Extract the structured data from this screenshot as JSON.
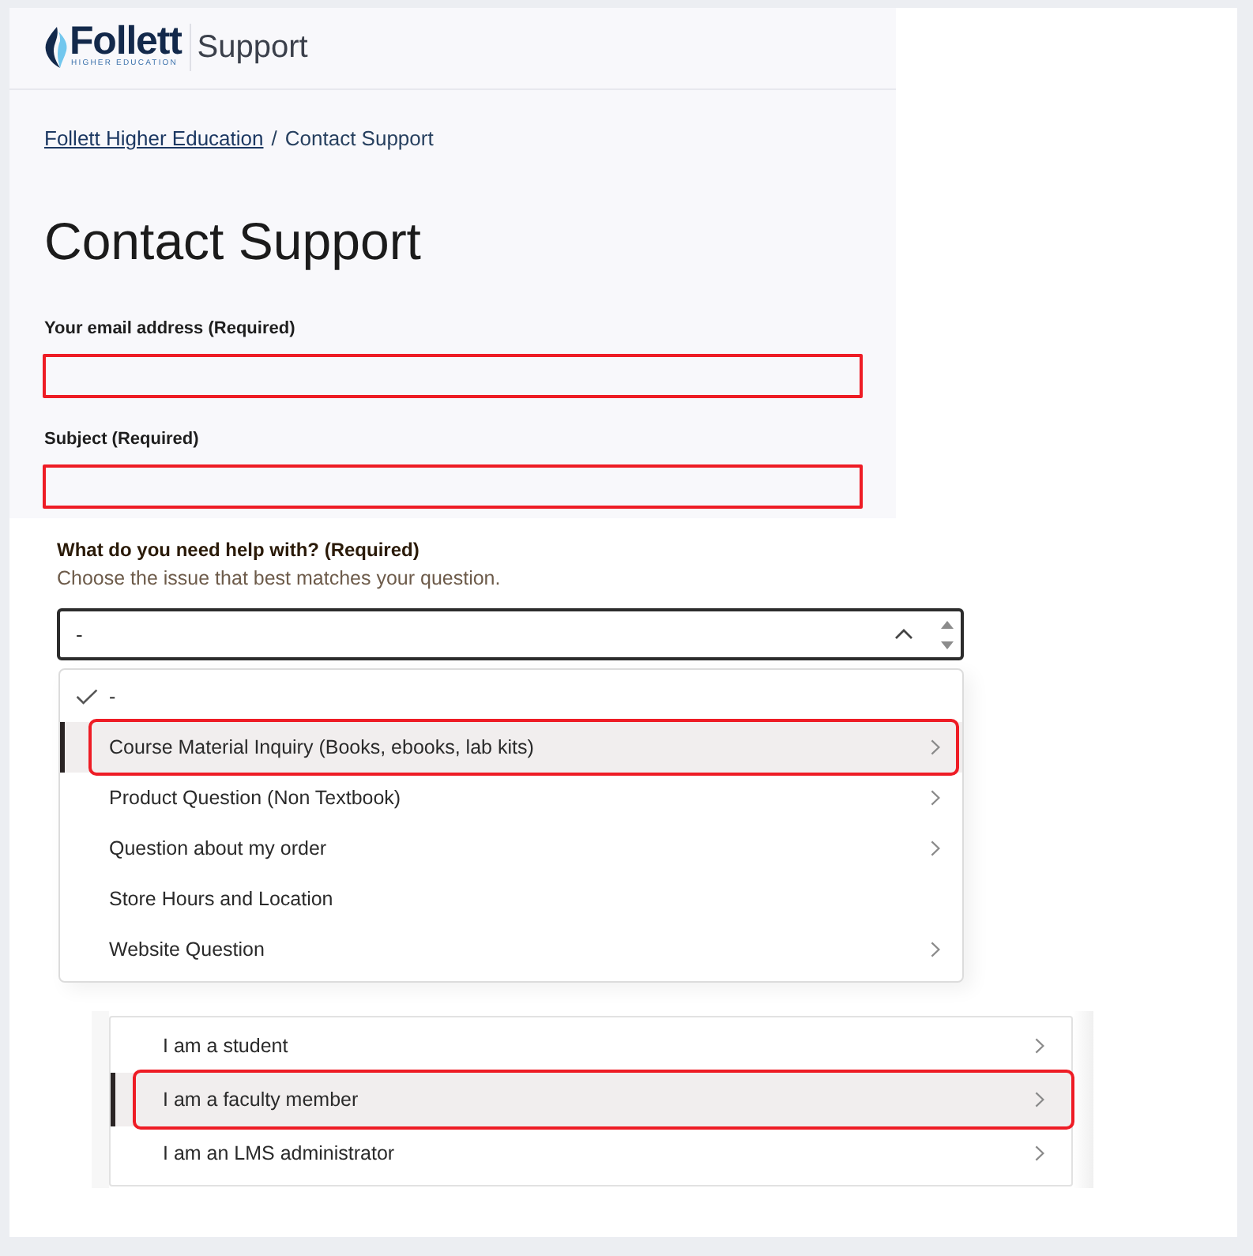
{
  "header": {
    "logo": {
      "wordmark": "Follett",
      "tagline": "HIGHER EDUCATION"
    },
    "title": "Support"
  },
  "breadcrumb": {
    "separator": "/",
    "items": [
      {
        "label": "Follett Higher Education",
        "link": true
      },
      {
        "label": "Contact Support",
        "link": false
      }
    ]
  },
  "page_title": "Contact Support",
  "fields": [
    {
      "label": "Your email address (Required)",
      "highlighted": true
    },
    {
      "label": "Subject (Required)",
      "highlighted": true
    }
  ],
  "help_select": {
    "label": "What do you need help with? (Required)",
    "hint": "Choose the issue that best matches your question.",
    "value": "-",
    "expanded": true,
    "options": [
      {
        "label": "-",
        "selected": true,
        "focused": false,
        "highlighted": false,
        "has_submenu": false
      },
      {
        "label": "Course Material Inquiry (Books, ebooks, lab kits)",
        "selected": false,
        "focused": true,
        "highlighted": true,
        "has_submenu": true
      },
      {
        "label": "Product Question (Non Textbook)",
        "selected": false,
        "focused": false,
        "highlighted": false,
        "has_submenu": true
      },
      {
        "label": "Question about my order",
        "selected": false,
        "focused": false,
        "highlighted": false,
        "has_submenu": true
      },
      {
        "label": "Store Hours and Location",
        "selected": false,
        "focused": false,
        "highlighted": false,
        "has_submenu": false
      },
      {
        "label": "Website Question",
        "selected": false,
        "focused": false,
        "highlighted": false,
        "has_submenu": true
      }
    ]
  },
  "audience_list": {
    "options": [
      {
        "label": "I am a student",
        "focused": false,
        "highlighted": false,
        "has_submenu": true
      },
      {
        "label": "I am a faculty member",
        "focused": true,
        "highlighted": true,
        "has_submenu": true
      },
      {
        "label": "I am an LMS administrator",
        "focused": false,
        "highlighted": false,
        "has_submenu": true
      }
    ]
  }
}
